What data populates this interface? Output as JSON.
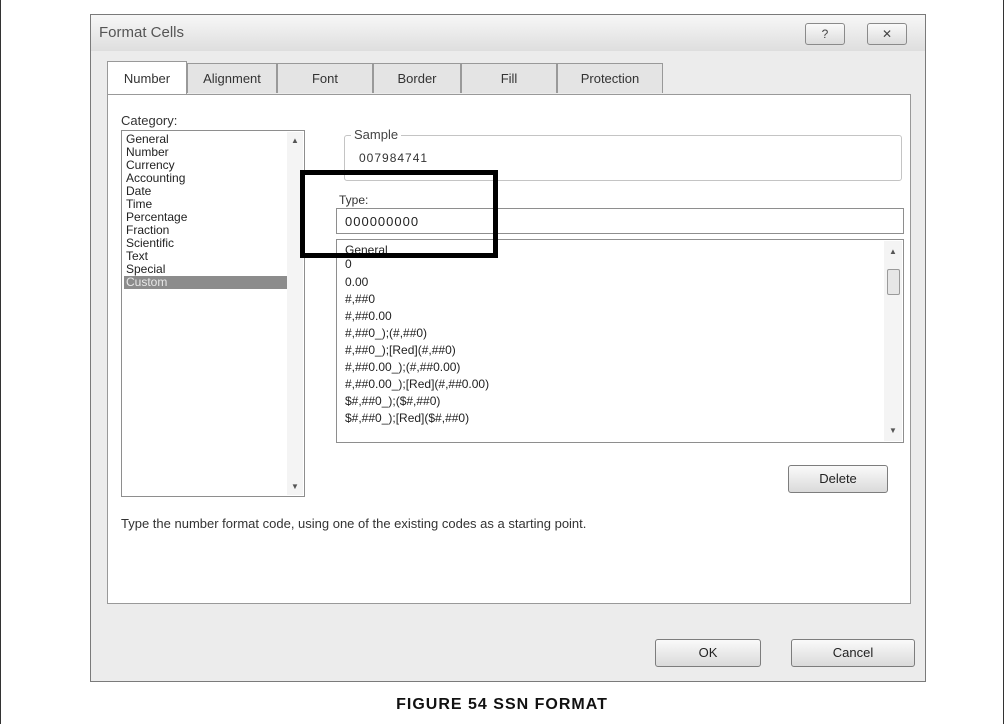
{
  "dialog": {
    "title": "Format Cells",
    "help_btn": "?",
    "close_btn": "✕"
  },
  "tabs": [
    "Number",
    "Alignment",
    "Font",
    "Border",
    "Fill",
    "Protection"
  ],
  "active_tab": "Number",
  "category": {
    "label": "Category:",
    "items": [
      "General",
      "Number",
      "Currency",
      "Accounting",
      "Date",
      "Time",
      "Percentage",
      "Fraction",
      "Scientific",
      "Text",
      "Special",
      "Custom"
    ],
    "selected": "Custom"
  },
  "sample": {
    "label": "Sample",
    "value": "007984741"
  },
  "type": {
    "label": "Type:",
    "value": "000000000"
  },
  "formats": [
    "General",
    "0",
    "0.00",
    "#,##0",
    "#,##0.00",
    "#,##0_);(#,##0)",
    "#,##0_);[Red](#,##0)",
    "#,##0.00_);(#,##0.00)",
    "#,##0.00_);[Red](#,##0.00)",
    "$#,##0_);($#,##0)",
    "$#,##0_);[Red]($#,##0)"
  ],
  "delete_label": "Delete",
  "hint": "Type the number format code, using one of the existing codes as a starting point.",
  "ok_label": "OK",
  "cancel_label": "Cancel",
  "caption": "FIGURE 54 SSN FORMAT",
  "icons": {
    "scroll_up": "▲",
    "scroll_down": "▼"
  }
}
